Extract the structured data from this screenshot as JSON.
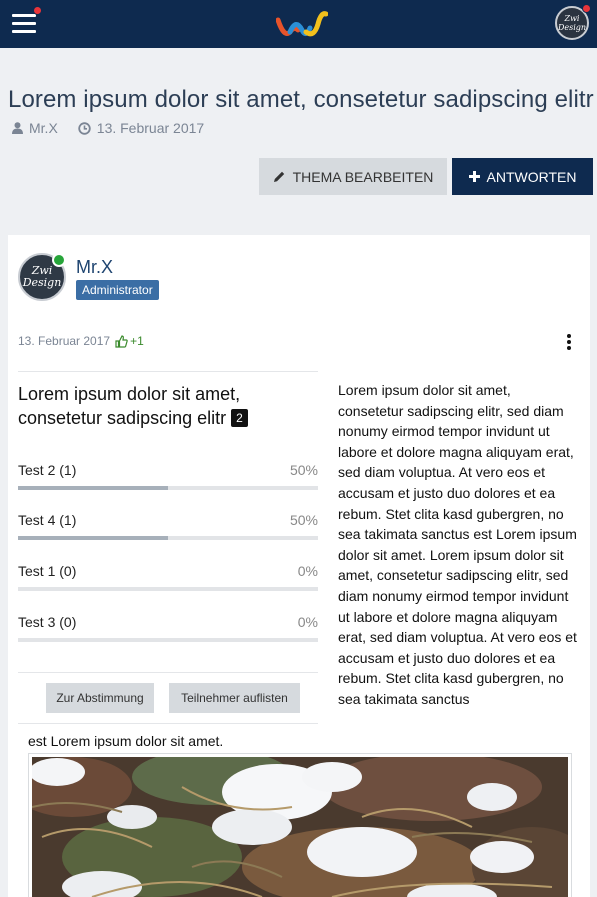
{
  "topbar": {
    "menu_icon": "hamburger-menu-icon",
    "logo_icon": "brand-logo-w-icon",
    "user_avatar_text": "Zwi Design",
    "colors": {
      "bar": "#0e2a4f",
      "notification": "#e8343a"
    }
  },
  "thread": {
    "title": "Lorem ipsum dolor sit amet, consetetur sadipscing elitr",
    "author": "Mr.X",
    "date": "13. Februar 2017",
    "edit_button": "THEMA BEARBEITEN",
    "reply_button": "ANTWORTEN"
  },
  "post": {
    "author": "Mr.X",
    "role": "Administrator",
    "avatar_text": "Zwi Design",
    "date": "13. Februar 2017",
    "likes": "+1",
    "poll": {
      "title": "Lorem ipsum dolor sit amet, consetetur sadipscing elitr",
      "vote_count": "2",
      "options": [
        {
          "label": "Test 2 (1)",
          "percent": "50%",
          "fraction": 0.5
        },
        {
          "label": "Test 4 (1)",
          "percent": "50%",
          "fraction": 0.5
        },
        {
          "label": "Test 1 (0)",
          "percent": "0%",
          "fraction": 0
        },
        {
          "label": "Test 3 (0)",
          "percent": "0%",
          "fraction": 0
        }
      ],
      "vote_button": "Zur Abstimmung",
      "list_button": "Teilnehmer auflisten"
    },
    "body_main": "Lorem ipsum dolor sit amet, consetetur sadipscing elitr, sed diam nonumy eirmod tempor invidunt ut labore et dolore magna aliquyam erat, sed diam voluptua. At vero eos et accusam et justo duo dolores et ea rebum. Stet clita kasd gubergren, no sea takimata sanctus est Lorem ipsum dolor sit amet. Lorem ipsum dolor sit amet, consetetur sadipscing elitr, sed diam nonumy eirmod tempor invidunt ut labore et dolore magna aliquyam erat, sed diam voluptua. At vero eos et accusam et justo duo dolores et ea rebum. Stet clita kasd gubergren, no sea takimata sanctus",
    "body_tail": "est Lorem ipsum dolor sit amet."
  }
}
